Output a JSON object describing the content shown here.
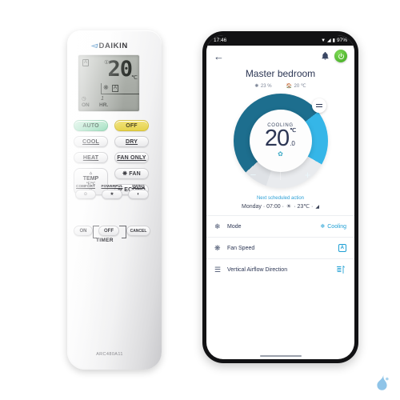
{
  "remote": {
    "brand": "DAIKIN",
    "model": "ARC480A11",
    "lcd": {
      "auto_badge": "A",
      "clock_icon": "clock-icon",
      "temperature": "20",
      "unit": "℃",
      "fan_icon": "fan-icon",
      "fan_mode": "A",
      "timer_label": "ON",
      "timer_value": "1",
      "timer_unit": "HR."
    },
    "buttons": {
      "auto": "AUTO",
      "off": "OFF",
      "cool": "COOL",
      "dry": "DRY",
      "heat": "HEAT",
      "fan_only": "FAN ONLY",
      "temp": "TEMP",
      "temp_sub": "℉/℃",
      "fan": "FAN",
      "econo": "ECONO",
      "comfort": "COMFORT",
      "powerful": "POWERFUL",
      "swing": "SWING",
      "timer_on": "ON",
      "timer_off": "OFF",
      "timer_cancel": "CANCEL",
      "timer_label": "TIMER"
    }
  },
  "phone": {
    "status": {
      "time": "17:46",
      "battery": "97%"
    },
    "appbar": {
      "back": "←",
      "bell": "bell-icon",
      "power": "power-icon"
    },
    "header": {
      "room": "Master bedroom",
      "humidity": "23 %",
      "outdoor_temp": "20 ℃"
    },
    "dial": {
      "mode": "COOLING",
      "value": "20",
      "unit": "℃",
      "decimal": ".0",
      "leaf": "leaf-icon",
      "minus": "−",
      "plus": "+",
      "menu": "menu-icon"
    },
    "schedule": {
      "title": "Next scheduled action",
      "detail": "Monday · 07:00 ·",
      "temp": "· 23℃ ·"
    },
    "rows": [
      {
        "icon": "mode-icon",
        "label": "Mode",
        "value": "Cooling",
        "value_type": "text"
      },
      {
        "icon": "fan-icon",
        "label": "Fan Speed",
        "value": "A",
        "value_type": "auto-box"
      },
      {
        "icon": "airflow-icon",
        "label": "Vertical Airflow Direction",
        "value": "",
        "value_type": "airflow"
      }
    ]
  },
  "watermark": {
    "name": "droplet-logo"
  },
  "colors": {
    "accent_blue": "#1e9fd4",
    "dial_dark": "#1d6e8e",
    "dial_light": "#35b6e8",
    "navy": "#2c3654",
    "auto_green": "#8fd9b4",
    "off_yellow": "#e6d34d",
    "power_green": "#3ea81f"
  }
}
